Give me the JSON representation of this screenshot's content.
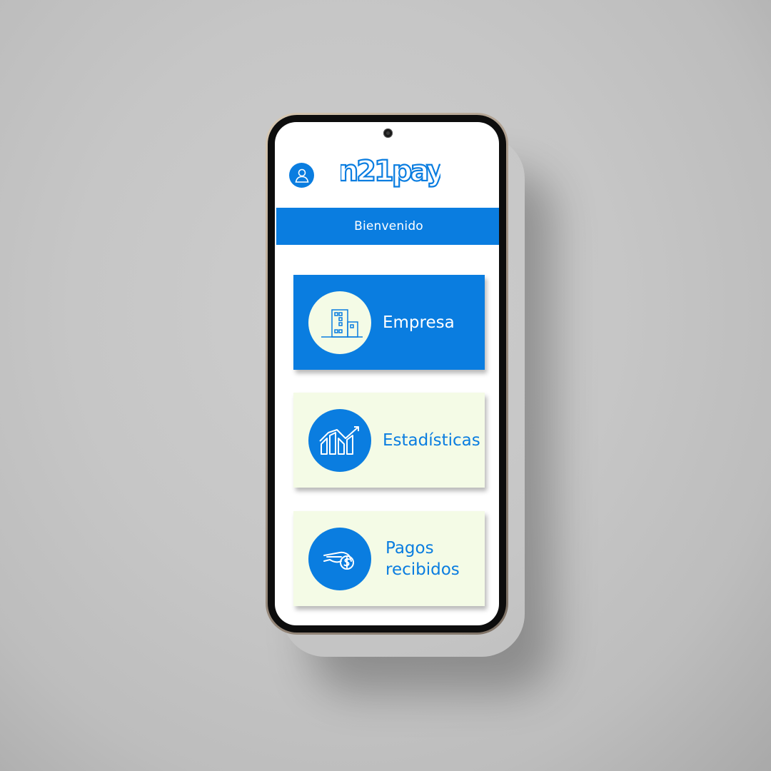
{
  "app": {
    "brand": "n21pay"
  },
  "header": {
    "welcome": "Bienvenido"
  },
  "menu": [
    {
      "label": "Empresa",
      "icon": "building-icon",
      "active": true
    },
    {
      "label": "Estadísticas",
      "icon": "chart-icon",
      "active": false
    },
    {
      "label": "Pagos recibidos",
      "icon": "payment-hand-icon",
      "active": false
    }
  ],
  "colors": {
    "primary": "#0a7de0",
    "card_light": "#f4fbe6",
    "text_light": "#ffffff"
  }
}
